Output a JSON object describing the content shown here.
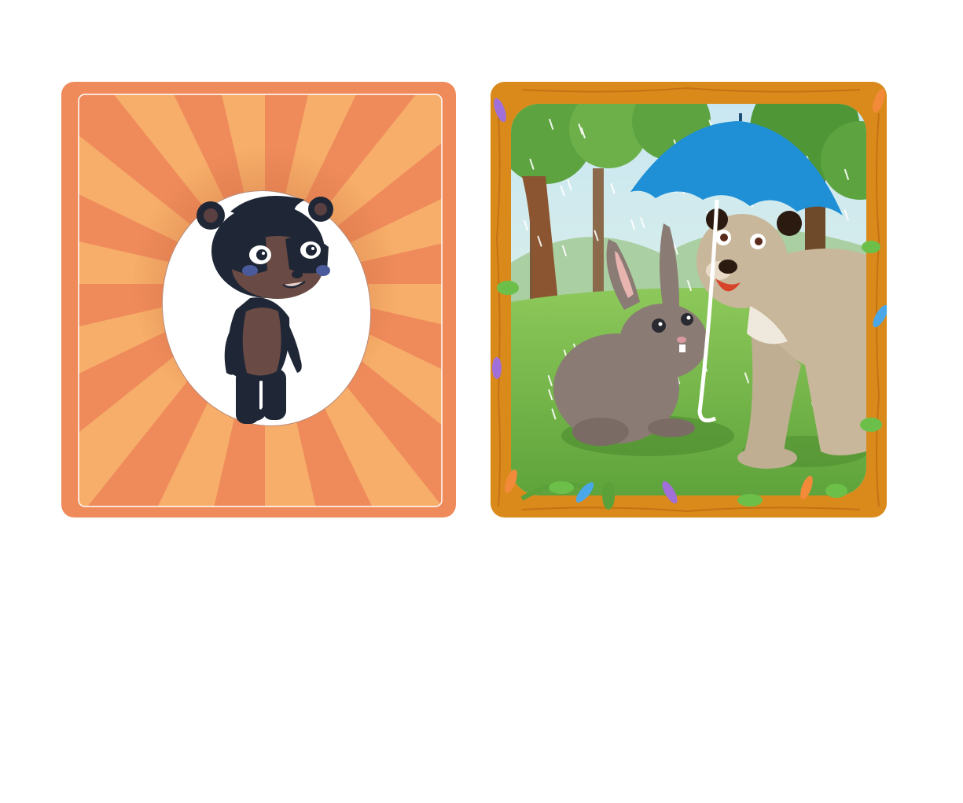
{
  "game": {
    "cards": [
      {
        "id": "character-card",
        "subject": "bear-character-icon",
        "accent": "#ef8b5b",
        "ray_color": "#f7ae6a"
      },
      {
        "id": "scene-card",
        "subject": "rabbit-and-lion-in-rain-scene",
        "frame_color": "#d98a1b",
        "umbrella_color": "#1f8fd6",
        "grass_color": "#7cbf4a"
      }
    ]
  }
}
